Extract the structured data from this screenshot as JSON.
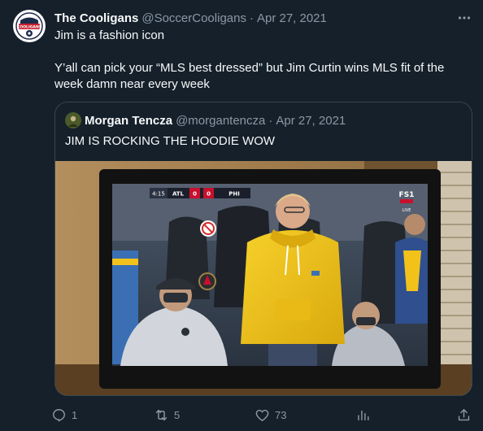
{
  "tweet": {
    "author_name": "The Cooligans",
    "handle": "@SoccerCooligans",
    "separator": "·",
    "date": "Apr 27, 2021",
    "avatar_text": "COOLIGANS",
    "lines": [
      "Jim is a fashion icon",
      "Y’all can pick your “MLS best dressed” but Jim Curtin wins MLS fit of the week damn near every week"
    ]
  },
  "quoted": {
    "author_name": "Morgan Tencza",
    "handle": "@morgantencza",
    "separator": "·",
    "date": "Apr 27, 2021",
    "text": "JIM IS ROCKING THE HOODIE WOW",
    "scorebug": {
      "clock": "4:15",
      "home": "ATL",
      "home_score": "0",
      "away_score": "0",
      "away": "PHI",
      "network": "FS1",
      "live": "LIVE"
    }
  },
  "actions": {
    "replies": "1",
    "retweets": "5",
    "likes": "73"
  },
  "colors": {
    "background": "#15202b",
    "text": "#f7f9f9",
    "muted": "#8b98a5",
    "border": "#38444d",
    "hoodie": "#f2c21b"
  },
  "icons": [
    "more-icon",
    "reply-icon",
    "retweet-icon",
    "like-icon",
    "analytics-icon",
    "share-icon"
  ]
}
